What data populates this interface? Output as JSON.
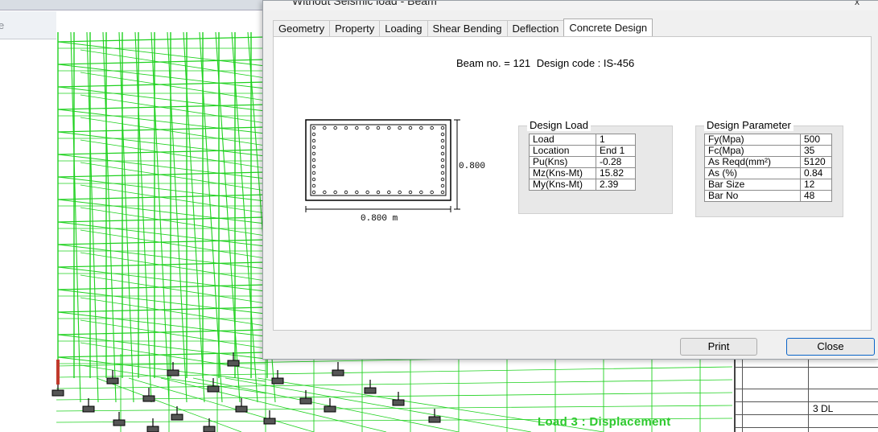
{
  "viewport": {
    "left_hint": "e",
    "load_caption": "Load 3 : Displacement",
    "table_cell": "3 DL"
  },
  "dialog": {
    "title": "Without Seismic load - Beam",
    "close_glyph": "x",
    "tabs": [
      {
        "label": "Geometry",
        "active": false
      },
      {
        "label": "Property",
        "active": false
      },
      {
        "label": "Loading",
        "active": false
      },
      {
        "label": "Shear Bending",
        "active": false
      },
      {
        "label": "Deflection",
        "active": false
      },
      {
        "label": "Concrete Design",
        "active": true
      }
    ],
    "header": {
      "beam_label": "Beam no. = 121",
      "code_label": "Design code :  IS-456"
    },
    "section": {
      "width_label": "0.800 m",
      "height_label": "0.800"
    },
    "design_load": {
      "title": "Design Load",
      "rows": [
        {
          "label": "Load",
          "value": "1"
        },
        {
          "label": "Location",
          "value": "End 1"
        },
        {
          "label": "Pu(Kns)",
          "value": "-0.28"
        },
        {
          "label": "Mz(Kns-Mt)",
          "value": "15.82"
        },
        {
          "label": "My(Kns-Mt)",
          "value": "2.39"
        }
      ]
    },
    "design_parameter": {
      "title": "Design Parameter",
      "rows": [
        {
          "label": "Fy(Mpa)",
          "value": "500"
        },
        {
          "label": "Fc(Mpa)",
          "value": "35"
        },
        {
          "label": "As Reqd(mm²)",
          "value": "5120"
        },
        {
          "label": "As (%)",
          "value": "0.84"
        },
        {
          "label": "Bar Size",
          "value": "12"
        },
        {
          "label": "Bar No",
          "value": "48"
        }
      ]
    },
    "buttons": {
      "print": "Print",
      "close": "Close"
    }
  },
  "colors": {
    "frame_green": "#1fd11f",
    "caption_green": "#2ec92e",
    "member_highlight": "#c0392b"
  }
}
